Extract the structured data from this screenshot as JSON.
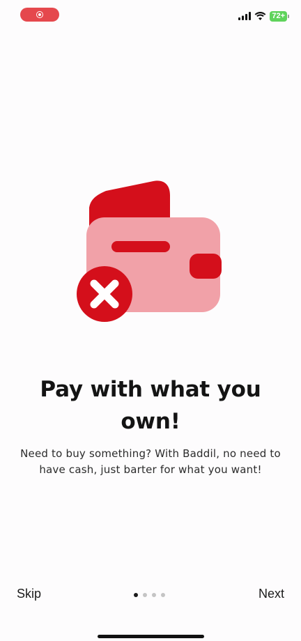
{
  "status_bar": {
    "battery_level": "72+",
    "icons": [
      "record-indicator",
      "cellular-signal-icon",
      "wifi-icon",
      "battery-icon"
    ],
    "colors": {
      "record": "#e5484d",
      "battery": "#5fd35c"
    }
  },
  "onboarding": {
    "illustration_icon": "wallet-with-x-icon",
    "illustration_colors": {
      "primary": "#d40f1b",
      "secondary": "#f1a1a8"
    },
    "title": "Pay with what you own!",
    "description": "Need to buy something? With Baddil, no need to have cash, just barter for what you want!"
  },
  "navigation": {
    "skip_label": "Skip",
    "next_label": "Next",
    "page_count": 4,
    "current_page": 1
  }
}
